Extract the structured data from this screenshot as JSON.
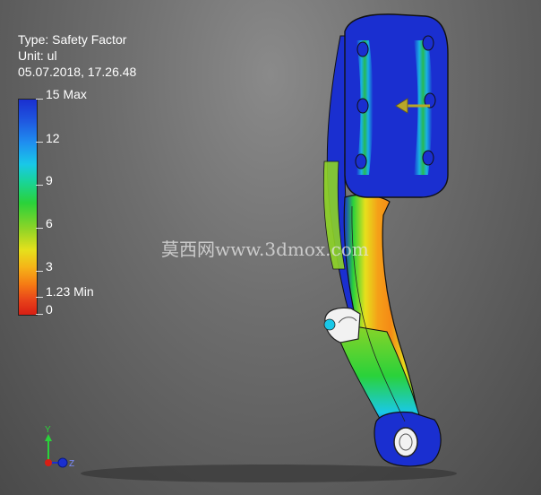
{
  "info": {
    "type_line": "Type: Safety Factor",
    "unit_line": "Unit: ul",
    "date_line": "05.07.2018, 17.26.48"
  },
  "legend": {
    "labels": [
      "15 Max",
      "12",
      "9",
      "6",
      "3",
      "1.23 Min",
      "0"
    ],
    "colors": {
      "max": "#1a2fd0",
      "mid_high": "#19c8e8",
      "mid": "#2ad23a",
      "mid_low": "#e6e01c",
      "low": "#f57a14",
      "min": "#d81e14"
    }
  },
  "watermark": "莫西网www.3dmox.com",
  "triad": {
    "y_label": "Y",
    "z_label": "Z"
  }
}
